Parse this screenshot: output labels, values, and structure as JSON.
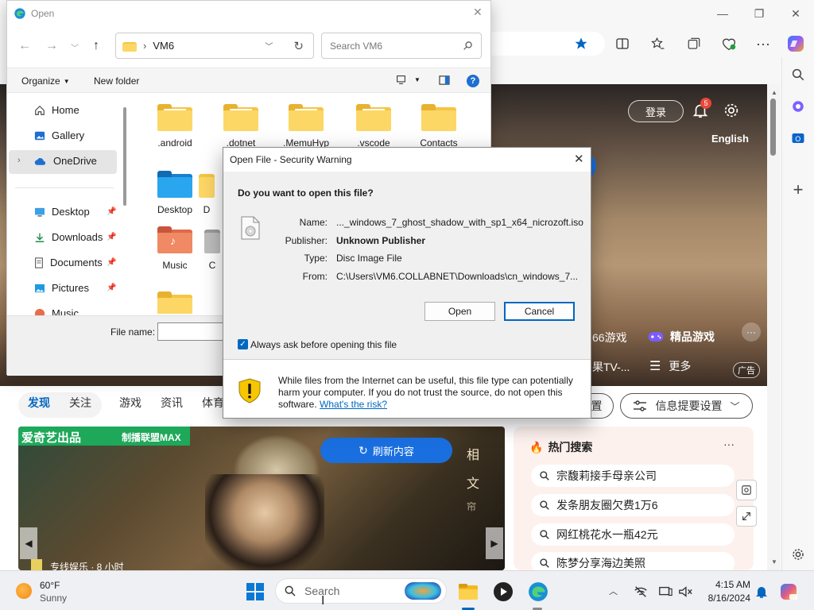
{
  "browser": {
    "window_controls": {
      "minimize": "—",
      "restore": "❐",
      "close": "✕"
    },
    "accent": "#0067c0"
  },
  "hero": {
    "login_label": "登录",
    "notification_count": "5",
    "language": "English",
    "menu_items": [
      "66游戏",
      "精品游戏",
      "果TV-...",
      "更多"
    ],
    "ad_label": "广告"
  },
  "news_tabs": [
    "发现",
    "关注",
    "游戏",
    "资讯",
    "体育"
  ],
  "settings_buttons": {
    "left": "置",
    "info": "信息提要设置"
  },
  "video": {
    "brand_left": "爱奇艺出品",
    "brand_right": "制播联盟MAX",
    "refresh_label": "刷新内容",
    "side_text": [
      "相",
      "文",
      "帘"
    ],
    "caption": "专线娱乐 · 8 小时"
  },
  "hot_search": {
    "title": "热门搜索",
    "more": "···",
    "items": [
      "宗馥莉接手母亲公司",
      "发条朋友圈欠费1万6",
      "网红桃花水一瓶42元",
      "陈梦分享海边美照"
    ]
  },
  "file_dialog": {
    "title": "Open",
    "path_folder": "VM6",
    "search_placeholder": "Search VM6",
    "organize": "Organize",
    "new_folder": "New folder",
    "nav": {
      "home": "Home",
      "gallery": "Gallery",
      "onedrive": "OneDrive",
      "desktop": "Desktop",
      "downloads": "Downloads",
      "documents": "Documents",
      "pictures": "Pictures",
      "music": "Music"
    },
    "items_row1": [
      ".android",
      ".dotnet",
      ".MemuHyp",
      ".vscode",
      "Contacts"
    ],
    "items_row2": [
      "Desktop",
      "D"
    ],
    "items_row3": [
      "Music",
      "C"
    ],
    "file_name_label": "File name:"
  },
  "security_dialog": {
    "title": "Open File - Security Warning",
    "question": "Do you want to open this file?",
    "labels": {
      "name": "Name:",
      "publisher": "Publisher:",
      "type": "Type:",
      "from": "From:"
    },
    "values": {
      "name": "..._windows_7_ghost_shadow_with_sp1_x64_nicrozoft.iso",
      "publisher": "Unknown Publisher",
      "type": "Disc Image File",
      "from": "C:\\Users\\VM6.COLLABNET\\Downloads\\cn_windows_7..."
    },
    "open_button": "Open",
    "cancel_button": "Cancel",
    "checkbox_label": "Always ask before opening this file",
    "checkbox_checked": true,
    "warning_text": "While files from the Internet can be useful, this file type can potentially harm your computer. If you do not trust the source, do not open this software.",
    "risk_link": "What's the risk?"
  },
  "taskbar": {
    "weather_temp": "60°F",
    "weather_desc": "Sunny",
    "search_placeholder": "Search",
    "time": "4:15 AM",
    "date": "8/16/2024"
  }
}
